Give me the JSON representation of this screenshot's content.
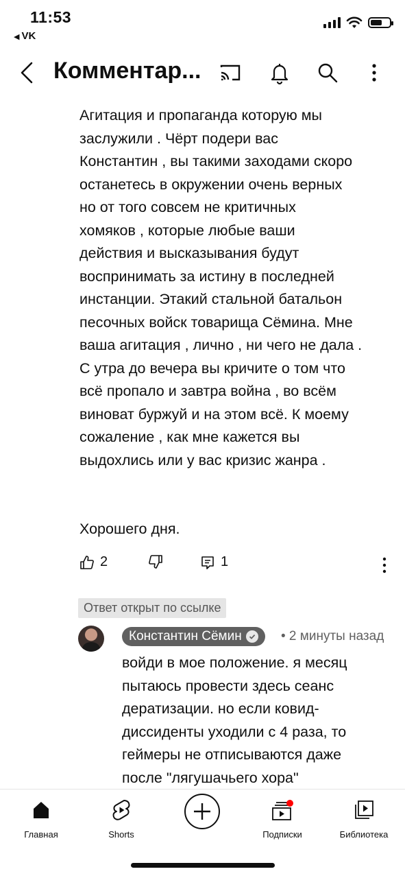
{
  "status_bar": {
    "time": "11:53",
    "back_app": "VK"
  },
  "header": {
    "title": "Комментар..."
  },
  "comment": {
    "lines": [
      " Агитация и пропаганда которую мы",
      "заслужили . Чёрт подери вас",
      "Константин , вы такими заходами скоро",
      "останетесь в окружении очень верных",
      "но от того совсем не критичных",
      "хомяков , которые любые ваши",
      "действия и высказывания будут",
      "воспринимать за истину в последней",
      "инстанции. Этакий стальной батальон",
      "песочных войск товарища Сёмина. Мне",
      "ваша агитация , лично , ни чего не дала .",
      "С утра до вечера вы кричите о том что",
      "всё пропало и завтра война , во всём",
      "виноват буржуй и на этом всё. К моему",
      "сожаление , как мне кажется вы",
      "выдохлись или у вас кризис жанра ."
    ],
    "closing": "Хорошего дня.",
    "likes": "2",
    "replies": "1"
  },
  "linked_badge": "Ответ открыт по ссылке",
  "reply": {
    "author": "Константин Сёмин",
    "time_ago": "• 2 минуты назад",
    "lines": [
      "войди в мое положение. я месяц",
      "пытаюсь провести здесь сеанс",
      "дератизации. но если ковид-",
      "диссиденты уходили с 4 раза, то",
      "геймеры не отписываются даже",
      "после \"лягушачьего хора\""
    ]
  },
  "bottom_nav": {
    "home": "Главная",
    "shorts": "Shorts",
    "subscriptions": "Подписки",
    "library": "Библиотека"
  },
  "colors": {
    "text": "#0f0f0f",
    "secondary": "#606060",
    "notification_dot": "#ff0000"
  }
}
